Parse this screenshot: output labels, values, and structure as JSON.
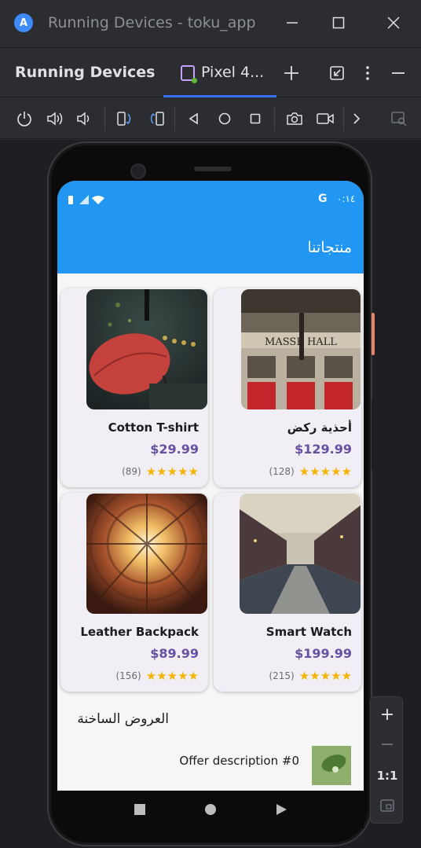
{
  "window": {
    "title": "Running Devices - toku_app",
    "logo_letter": "A"
  },
  "panel": {
    "title": "Running Devices",
    "tab_label": "Pixel 4...",
    "accent": "#3574f0"
  },
  "toolbar": {
    "icons": [
      "power-icon",
      "volume-up-icon",
      "volume-down-icon",
      "rotate-left-icon",
      "rotate-right-icon",
      "back-icon",
      "home-icon",
      "overview-icon",
      "camera-icon",
      "record-icon",
      "more-chevron-icon",
      "device-mirror-icon"
    ]
  },
  "phone": {
    "status": {
      "time": "٠:١٤",
      "google_letter": "G"
    },
    "appbar_title": "منتجاتنا",
    "primary_color": "#2196f3",
    "products": [
      {
        "name": "Cotton T-shirt",
        "price": "$29.99",
        "rating_count": "(89)",
        "stars": "★★★★★",
        "rating": 5
      },
      {
        "name": "أحذية ركض",
        "price": "$129.99",
        "rating_count": "(128)",
        "stars": "★★★★★",
        "rating": 5
      },
      {
        "name": "Leather Backpack",
        "price": "$89.99",
        "rating_count": "(156)",
        "stars": "★★★★★",
        "rating": 5
      },
      {
        "name": "Smart Watch",
        "price": "$199.99",
        "rating_count": "(215)",
        "stars": "★★★★★",
        "rating": 5
      }
    ],
    "hall_sign": "MASSE HALL",
    "section_title": "العروض الساخنة",
    "offers": [
      {
        "description": "Offer description #0"
      }
    ]
  },
  "zoom": {
    "zoom_in": "+",
    "zoom_out": "−",
    "actual_size": "1:1"
  }
}
